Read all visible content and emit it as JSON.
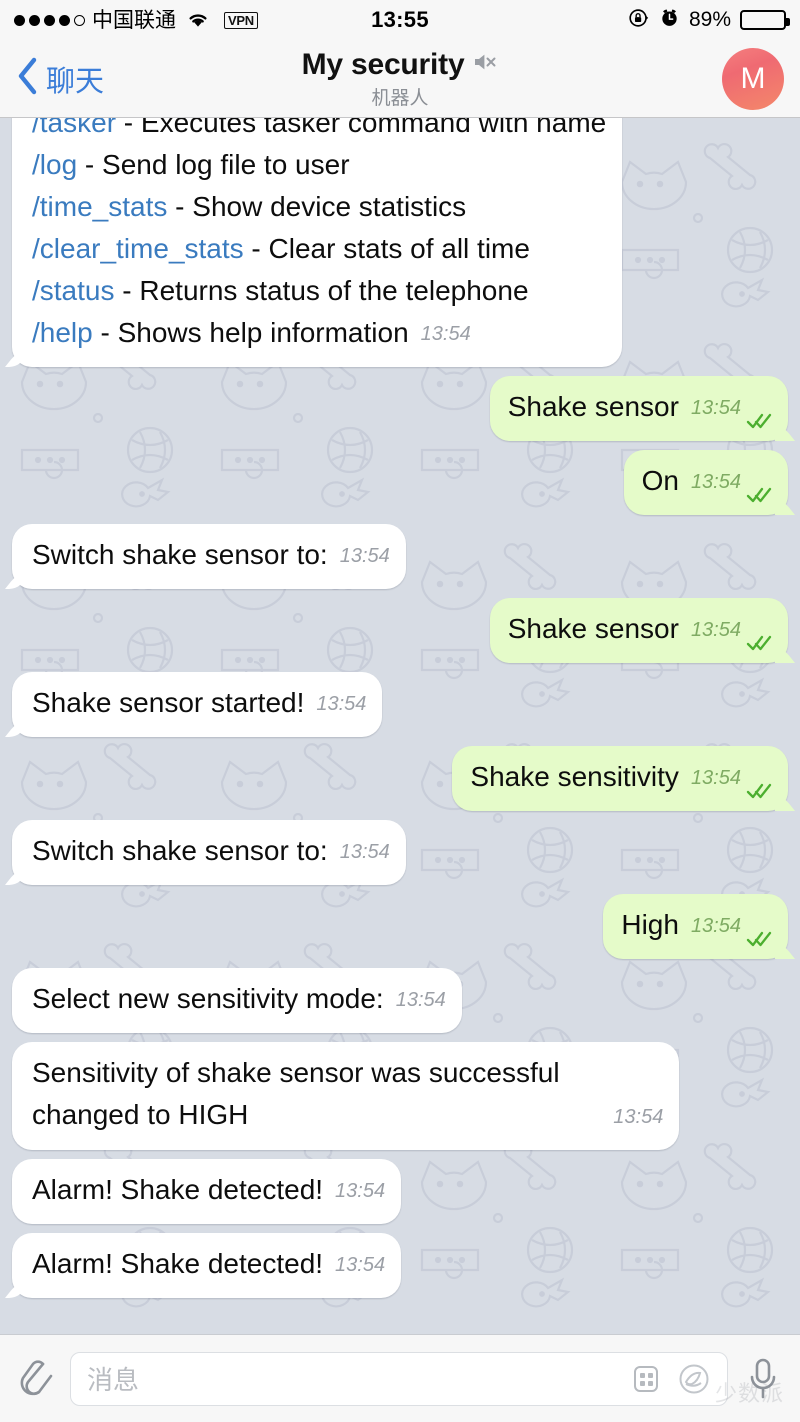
{
  "status_bar": {
    "carrier": "中国联通",
    "signal_dots_filled": 4,
    "signal_dots_total": 5,
    "vpn": "VPN",
    "time": "13:55",
    "battery_percent": "89%",
    "battery_level": 89,
    "icons": [
      "signal-dots",
      "wifi-icon",
      "vpn-badge",
      "rotation-lock-icon",
      "alarm-clock-icon",
      "battery-icon"
    ]
  },
  "nav": {
    "back_label": "聊天",
    "title": "My security",
    "subtitle": "机器人",
    "muted": true,
    "avatar_initial": "M",
    "avatar_color_start": "#f57f7f",
    "avatar_color_end": "#f4886a"
  },
  "theme": {
    "chat_background": "#d7dce4",
    "incoming_bubble": "#ffffff",
    "outgoing_bubble": "#e5fbc9",
    "link_color": "#3a7bbf",
    "accent_blue": "#3b7dd8",
    "tick_green": "#4caf2f"
  },
  "messages": [
    {
      "id": "m1",
      "side": "in",
      "tail": true,
      "clipped_top": true,
      "layout": "inline",
      "lines": [
        {
          "cmd": "/tasker",
          "rest": " - Executes tasker command with name"
        },
        {
          "cmd": "/log",
          "rest": " - Send log file to user"
        },
        {
          "cmd": "/time_stats",
          "rest": " - Show device statistics"
        },
        {
          "cmd": "/clear_time_stats",
          "rest": " - Clear stats of all time"
        },
        {
          "cmd": "/status",
          "rest": " - Returns status of the telephone"
        },
        {
          "cmd": "/help",
          "rest": " - Shows help information"
        }
      ],
      "time": "13:54"
    },
    {
      "id": "m2",
      "side": "out",
      "tail": true,
      "text": "Shake sensor",
      "time": "13:54",
      "status": "read"
    },
    {
      "id": "m3",
      "side": "out",
      "tail": true,
      "text": "On",
      "time": "13:54",
      "status": "read"
    },
    {
      "id": "m4",
      "side": "in",
      "tail": true,
      "text": "Switch shake sensor to:",
      "time": "13:54"
    },
    {
      "id": "m5",
      "side": "out",
      "tail": true,
      "text": "Shake sensor",
      "time": "13:54",
      "status": "read"
    },
    {
      "id": "m6",
      "side": "in",
      "tail": true,
      "text": "Shake sensor started!",
      "time": "13:54"
    },
    {
      "id": "m7",
      "side": "out",
      "tail": true,
      "text": "Shake sensitivity",
      "time": "13:54",
      "status": "read"
    },
    {
      "id": "m8",
      "side": "in",
      "tail": true,
      "text": "Switch shake sensor to:",
      "time": "13:54"
    },
    {
      "id": "m9",
      "side": "out",
      "tail": true,
      "text": "High",
      "time": "13:54",
      "status": "read"
    },
    {
      "id": "m10",
      "side": "in",
      "tail": false,
      "text": "Select new sensitivity mode:",
      "time": "13:54"
    },
    {
      "id": "m11",
      "side": "in",
      "tail": false,
      "layout": "block",
      "text": "Sensitivity of shake sensor was successful changed to HIGH",
      "time": "13:54"
    },
    {
      "id": "m12",
      "side": "in",
      "tail": false,
      "text": "Alarm! Shake detected!",
      "time": "13:54"
    },
    {
      "id": "m13",
      "side": "in",
      "tail": true,
      "text": "Alarm! Shake detected!",
      "time": "13:54"
    }
  ],
  "input_bar": {
    "attach_icon": "paperclip-icon",
    "placeholder": "消息",
    "keyboard_icon": "grid-keyboard-icon",
    "sticker_icon": "sticker-icon",
    "mic_icon": "microphone-icon"
  },
  "watermark": "少数派"
}
